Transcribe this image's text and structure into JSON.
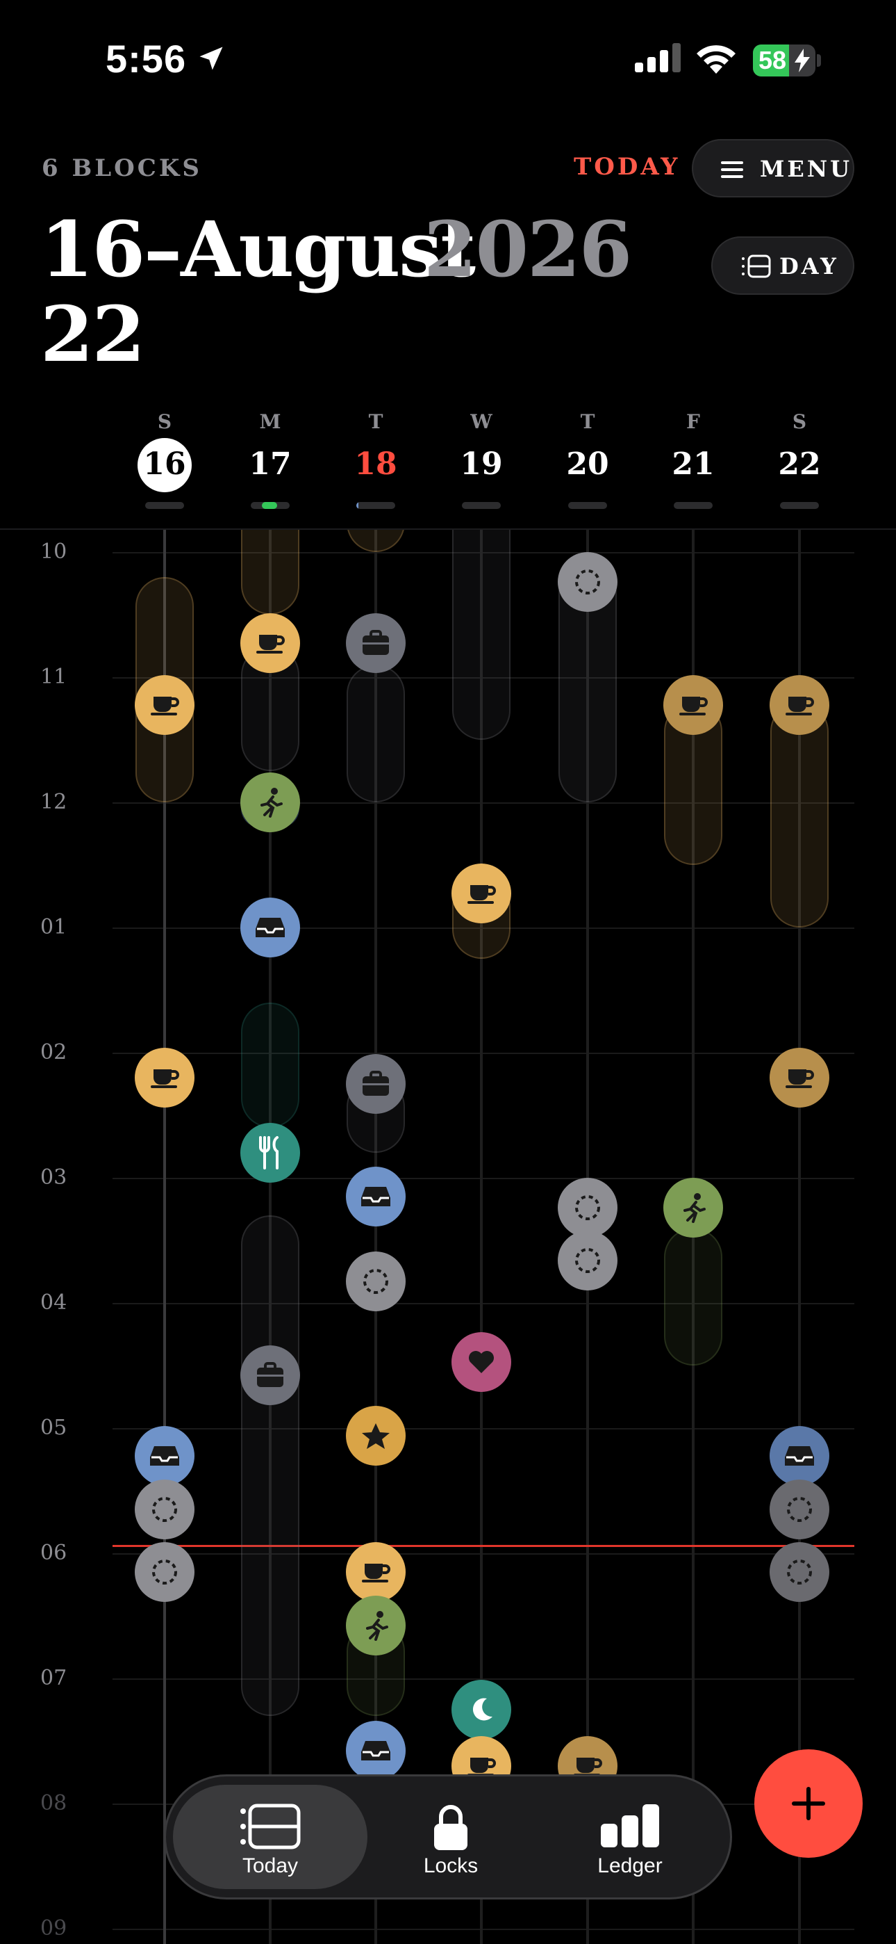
{
  "status_bar": {
    "time": "5:56",
    "battery": "58"
  },
  "header": {
    "blocks_label": "6 BLOCKS",
    "today_label": "TODAY",
    "menu_label": "MENU",
    "title_line1": "16–August",
    "title_line2": "22",
    "year": "2026",
    "view_label": "DAY"
  },
  "week": [
    {
      "weekday": "S",
      "day": "16",
      "selected": true
    },
    {
      "weekday": "M",
      "day": "17"
    },
    {
      "weekday": "T",
      "day": "18",
      "today": true
    },
    {
      "weekday": "W",
      "day": "19"
    },
    {
      "weekday": "T",
      "day": "20"
    },
    {
      "weekday": "F",
      "day": "21"
    },
    {
      "weekday": "S",
      "day": "22"
    }
  ],
  "hours": [
    "10",
    "11",
    "12",
    "01",
    "02",
    "03",
    "04",
    "05",
    "06",
    "07",
    "08",
    "09"
  ],
  "colors": {
    "coffee": "#e8b55f",
    "work": "#6e7079",
    "inbox": "#6f93c9",
    "run": "#7d9d54",
    "food": "#2f8f7f",
    "heart": "#b4527e",
    "star": "#d9a447",
    "moon": "#2f8f7f",
    "empty": "#8e8e93",
    "now_line": "#e0352b",
    "accent": "#ff4d3f"
  },
  "tabs": [
    {
      "label": "Today",
      "icon": "today-icon",
      "active": true
    },
    {
      "label": "Locks",
      "icon": "lock-icon"
    },
    {
      "label": "Ledger",
      "icon": "ledger-icon"
    }
  ]
}
